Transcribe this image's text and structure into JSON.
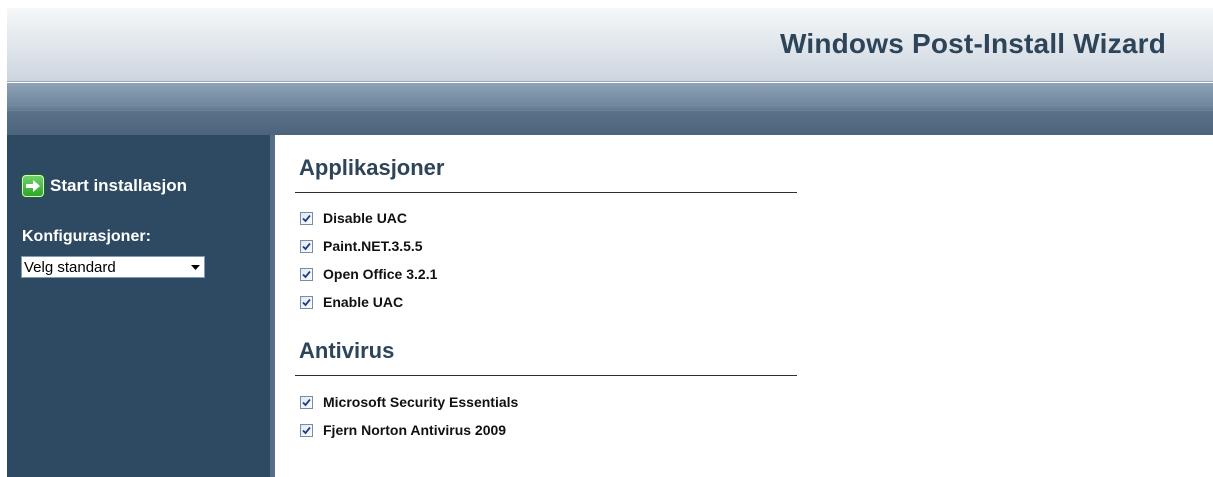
{
  "header": {
    "title": "Windows Post-Install Wizard"
  },
  "sidebar": {
    "start_label": "Start installasjon",
    "config_label": "Konfigurasjoner:",
    "config_selected": "Velg standard"
  },
  "sections": [
    {
      "title": "Applikasjoner",
      "items": [
        {
          "label": "Disable UAC",
          "checked": true
        },
        {
          "label": "Paint.NET.3.5.5",
          "checked": true
        },
        {
          "label": "Open Office 3.2.1",
          "checked": true
        },
        {
          "label": "Enable UAC",
          "checked": true
        }
      ]
    },
    {
      "title": "Antivirus",
      "items": [
        {
          "label": "Microsoft Security Essentials",
          "checked": true
        },
        {
          "label": "Fjern Norton Antivirus 2009",
          "checked": true
        }
      ]
    }
  ],
  "colors": {
    "header_text": "#2d4459",
    "sidebar_bg": "#2e4a62",
    "go_green": "#2ea629"
  },
  "icons": [
    "go-arrow-icon",
    "dropdown-arrow-icon",
    "checkbox-check-icon"
  ]
}
